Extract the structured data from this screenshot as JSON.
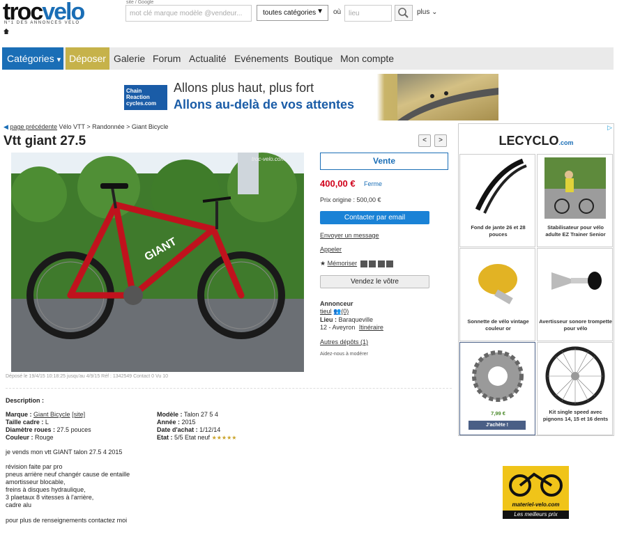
{
  "brand": {
    "troc": "troc",
    "velo": "velo",
    "tagline": "N°1 DES ANNONCES VELO"
  },
  "search": {
    "topnote": "site / Google",
    "placeholder": "mot clé marque modèle @vendeur...",
    "category": "toutes catégories",
    "ou": "où",
    "location_placeholder": "lieu",
    "plus": "plus"
  },
  "nav": {
    "categories": "Catégories",
    "deposer": "Déposer",
    "items": [
      "Galerie",
      "Forum",
      "Actualité",
      "Evénements",
      "Boutique",
      "Mon compte"
    ]
  },
  "banner": {
    "logo": "Chain Reaction cycles.com",
    "line1": "Allons plus haut, plus fort",
    "line2": "Allons au-delà de vos attentes"
  },
  "breadcrumb": {
    "back": "page précédente",
    "path": "Vélo VTT > Randonnée > Giant Bicycle"
  },
  "listing": {
    "title": "Vtt giant 27.5",
    "type": "Vente",
    "price": "400,00 €",
    "status": "Ferme",
    "original_price": "Prix origine : 500,00 €",
    "contact_button": "Contacter par email",
    "send_message": "Envoyer un message",
    "call": "Appeler",
    "memorize": "Mémoriser",
    "sell_yours": "Vendez le vôtre",
    "advertiser_label": "Annonceur",
    "advertiser_name": "tieul",
    "advertiser_count": "(0)",
    "place_label": "Lieu :",
    "place": "Baraqueville",
    "department": "12 - Aveyron",
    "itinerary": "Itinéraire",
    "other_deposits": "Autres dépôts (1)",
    "moderate": "Aidez-nous à modérer",
    "photo_info": "Déposé le 19/4/15 10:18:25 jusqu'au 4/9/15    Réf : 1342549 Contact 0 Vu 10",
    "watermark": "troc-velo.com"
  },
  "description": {
    "heading": "Description :",
    "left": [
      {
        "label": "Marque :",
        "value": "Giant Bicycle",
        "extra": "[site]"
      },
      {
        "label": "Taille cadre :",
        "value": "L"
      },
      {
        "label": "Diamètre roues :",
        "value": "27.5 pouces"
      },
      {
        "label": "Couleur :",
        "value": "Rouge"
      }
    ],
    "right": [
      {
        "label": "Modèle :",
        "value": "Talon 27 5 4"
      },
      {
        "label": "Année :",
        "value": "2015"
      },
      {
        "label": "Date d'achat :",
        "value": "1/12/14"
      },
      {
        "label": "Etat :",
        "value": "5/5 Etat neuf",
        "stars": "★★★★★"
      }
    ],
    "lines": [
      "je vends mon vtt GIANT talon 27.5 4 2015",
      "",
      "révision faite par pro",
      "pneus arrière neuf changér cause de entaille",
      "amortisseur blocable,",
      "freins à disques hydraulique,",
      "3 plaetaux 8 vitesses à l'arrière,",
      "cadre alu",
      "",
      "pour plus de renseignements contactez moi"
    ]
  },
  "ad": {
    "brand": "LECYCLO",
    "brand_suffix": ".com",
    "tiles": [
      {
        "caption": "Fond de jante 26 et 28 pouces"
      },
      {
        "caption": "Stabilisateur pour vélo adulte EZ Trainer Senior"
      },
      {
        "caption": "Sonnette de vélo vintage couleur or"
      },
      {
        "caption": "Avertisseur sonore trompette pour vélo"
      },
      {
        "caption": "7,99 €",
        "button": "J'achète !"
      },
      {
        "caption": "Kit single speed avec pignons 14, 15 et 16 dents"
      }
    ]
  },
  "ad2": {
    "url": "materiel-velo.com",
    "tagline": "Les meilleurs prix"
  },
  "colors": {
    "accent": "#1a6eb6",
    "price": "#d0021b",
    "deposer": "#c6b24a"
  }
}
